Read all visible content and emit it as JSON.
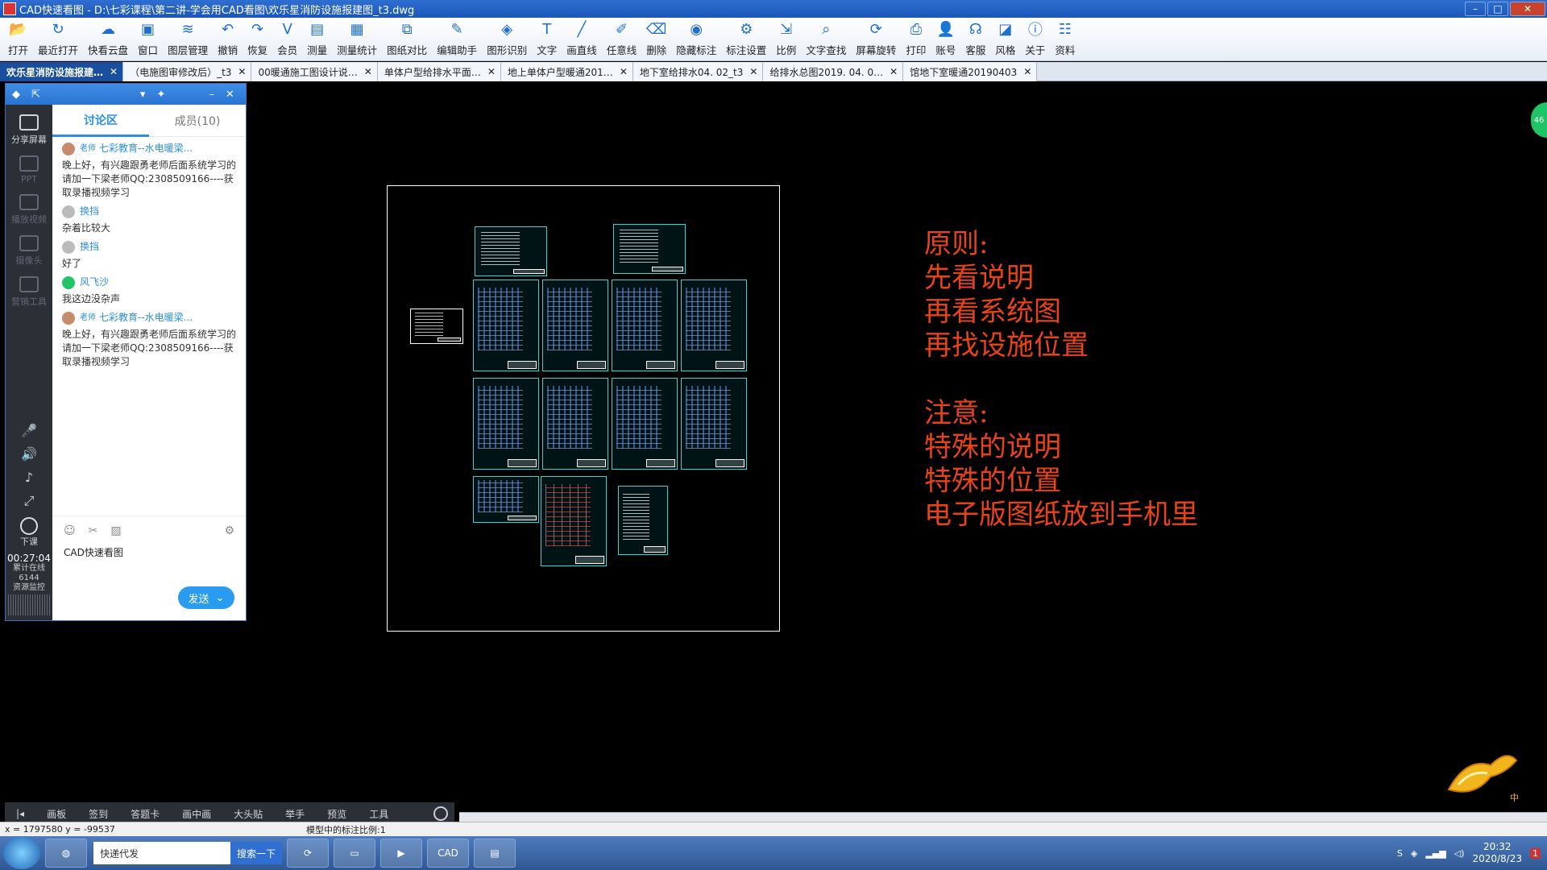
{
  "window": {
    "title": "CAD快速看图 - D:\\七彩课程\\第二讲-学会用CAD看图\\欢乐星消防设施报建图_t3.dwg",
    "min": "–",
    "max": "□",
    "close": "✕"
  },
  "toolbar": [
    {
      "label": "打开",
      "icon": "folder-open-icon",
      "glyph": "📂"
    },
    {
      "label": "最近打开",
      "icon": "history-icon",
      "glyph": "↻"
    },
    {
      "label": "快看云盘",
      "icon": "cloud-icon",
      "glyph": "☁"
    },
    {
      "label": "窗口",
      "icon": "window-icon",
      "glyph": "▣"
    },
    {
      "label": "图层管理",
      "icon": "layers-icon",
      "glyph": "≋"
    },
    {
      "label": "撤销",
      "icon": "undo-icon",
      "glyph": "↶"
    },
    {
      "label": "恢复",
      "icon": "redo-icon",
      "glyph": "↷"
    },
    {
      "label": "会员",
      "icon": "vip-icon",
      "glyph": "V"
    },
    {
      "label": "测量",
      "icon": "measure-icon",
      "glyph": "▤"
    },
    {
      "label": "测量统计",
      "icon": "stats-icon",
      "glyph": "▦"
    },
    {
      "label": "图纸对比",
      "icon": "compare-icon",
      "glyph": "⧉"
    },
    {
      "label": "编辑助手",
      "icon": "edit-helper-icon",
      "glyph": "✎"
    },
    {
      "label": "图形识别",
      "icon": "shape-recognize-icon",
      "glyph": "◈"
    },
    {
      "label": "文字",
      "icon": "text-icon",
      "glyph": "T"
    },
    {
      "label": "画直线",
      "icon": "line-icon",
      "glyph": "╱"
    },
    {
      "label": "任意线",
      "icon": "pen-icon",
      "glyph": "✐"
    },
    {
      "label": "删除",
      "icon": "eraser-icon",
      "glyph": "⌫"
    },
    {
      "label": "隐藏标注",
      "icon": "hide-eye-icon",
      "glyph": "◉"
    },
    {
      "label": "标注设置",
      "icon": "annotation-settings-icon",
      "glyph": "⚙"
    },
    {
      "label": "比例",
      "icon": "scale-icon",
      "glyph": "⇲"
    },
    {
      "label": "文字查找",
      "icon": "search-text-icon",
      "glyph": "⌕"
    },
    {
      "label": "屏幕旋转",
      "icon": "rotate-icon",
      "glyph": "⟳"
    },
    {
      "label": "打印",
      "icon": "print-icon",
      "glyph": "⎙"
    },
    {
      "label": "账号",
      "icon": "user-icon",
      "glyph": "👤"
    },
    {
      "label": "客服",
      "icon": "headset-icon",
      "glyph": "☊"
    },
    {
      "label": "风格",
      "icon": "style-icon",
      "glyph": "◪"
    },
    {
      "label": "关于",
      "icon": "info-icon",
      "glyph": "ⓘ"
    },
    {
      "label": "资料",
      "icon": "docs-icon",
      "glyph": "☷"
    }
  ],
  "tabs": [
    {
      "label": "欢乐星消防设施报建…",
      "active": true
    },
    {
      "label": "（电施图审修改后）_t3"
    },
    {
      "label": "00暖通施工图设计说…"
    },
    {
      "label": "单体户型给排水平面…"
    },
    {
      "label": "地上单体户型暖通201…"
    },
    {
      "label": "地下室给排水04. 02_t3"
    },
    {
      "label": "给排水总图2019. 04. 0…"
    },
    {
      "label": "馆地下室暖通20190403"
    }
  ],
  "chat": {
    "header_icons": [
      "◆",
      "⇱",
      "▾",
      "✦",
      "–",
      "✕"
    ],
    "side": [
      {
        "label": "分享屏幕",
        "dim": false
      },
      {
        "label": "PPT",
        "dim": true
      },
      {
        "label": "播放视频",
        "dim": true
      },
      {
        "label": "摄像头",
        "dim": true
      },
      {
        "label": "营销工具",
        "dim": true
      }
    ],
    "controls": [
      "🎤",
      "🔊",
      "♪",
      "⤢"
    ],
    "leave_label": "下课",
    "timer": "00:27:04",
    "online_label": "累计在线",
    "online_count": "6144",
    "monitor_label": "资源监控",
    "tab_discuss": "讨论区",
    "tab_members": "成员(10)",
    "messages": [
      {
        "tag": "老师",
        "name": "七彩教育--水电暖梁...",
        "text": "晚上好，有兴趣跟勇老师后面系统学习的请加一下梁老师QQ:2308509166----获取录播视频学习",
        "avatar": "teacher"
      },
      {
        "tag": "",
        "name": "换挡",
        "text": "杂着比较大",
        "avatar": "gray"
      },
      {
        "tag": "",
        "name": "换挡",
        "text": "好了",
        "avatar": "gray"
      },
      {
        "tag": "",
        "name": "风飞沙",
        "text": "我这边没杂声",
        "avatar": "green"
      },
      {
        "tag": "老师",
        "name": "七彩教育--水电暖梁...",
        "text": "晚上好，有兴趣跟勇老师后面系统学习的请加一下梁老师QQ:2308509166----获取录播视频学习",
        "avatar": "teacher"
      }
    ],
    "input_text": "CAD快速看图",
    "send_label": "发送"
  },
  "notes": {
    "line1": "原则:",
    "line2": "先看说明",
    "line3": "再看系统图",
    "line4": "再找设施位置",
    "line5": "注意:",
    "line6": "特殊的说明",
    "line7": "特殊的位置",
    "line8": "电子版图纸放到手机里"
  },
  "side_badge": "46",
  "mascot_label": "中",
  "class_bar": [
    "画板",
    "签到",
    "答题卡",
    "画中画",
    "大头贴",
    "举手",
    "预览",
    "工具"
  ],
  "status": {
    "coords": "x = 1797580  y = -99537",
    "scale": "模型中的标注比例:1"
  },
  "taskbar": {
    "search_value": "快递代发",
    "search_button": "搜索一下",
    "cad_label": "CAD",
    "time": "20:32",
    "date": "2020/8/23",
    "notify_count": "1"
  }
}
